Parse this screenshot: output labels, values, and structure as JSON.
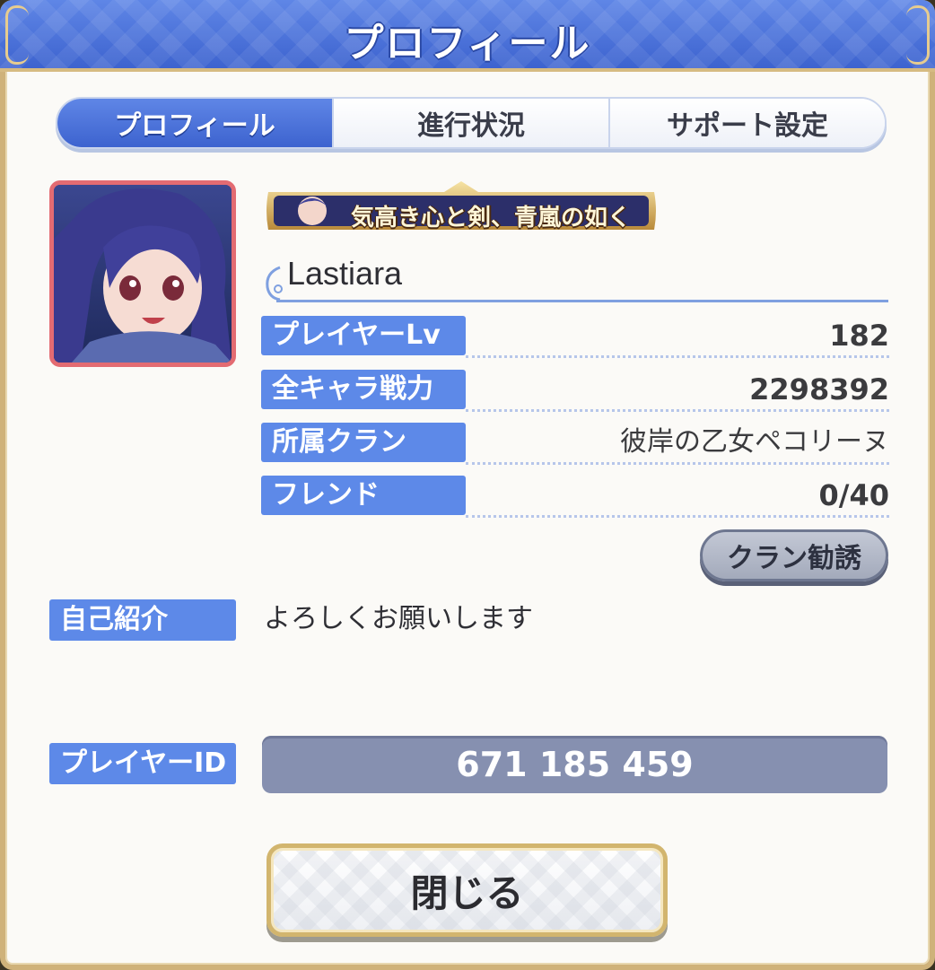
{
  "window": {
    "title": "プロフィール"
  },
  "tabs": [
    {
      "label": "プロフィール",
      "active": true
    },
    {
      "label": "進行状況",
      "active": false
    },
    {
      "label": "サポート設定",
      "active": false
    }
  ],
  "profile": {
    "title_banner": "気高き心と剣、青嵐の如く",
    "name": "Lastiara",
    "stats": [
      {
        "label": "プレイヤーLv",
        "value": "182"
      },
      {
        "label": "全キャラ戦力",
        "value": "2298392"
      },
      {
        "label": "所属クラン",
        "value": "彼岸の乙女ペコリーヌ"
      },
      {
        "label": "フレンド",
        "value": "0/40"
      }
    ],
    "clan_invite_label": "クラン勧誘",
    "intro_label": "自己紹介",
    "intro_text": "よろしくお願いします",
    "player_id_label": "プレイヤーID",
    "player_id": "671 185 459"
  },
  "close_label": "閉じる",
  "colors": {
    "header_blue": "#3d63cf",
    "label_blue": "#5d89e8",
    "gold_border": "#cfb27a",
    "avatar_border": "#e36b72",
    "id_box": "#8690b0"
  }
}
